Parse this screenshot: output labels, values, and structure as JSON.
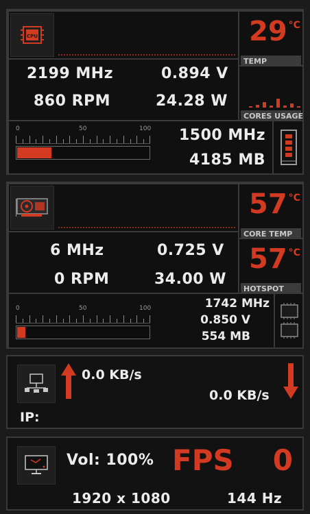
{
  "cpu": {
    "icon": "cpu-icon",
    "clock": "2199 MHz",
    "voltage": "0.894 V",
    "fan": "860 RPM",
    "power": "24.28 W",
    "temp_value": "29",
    "temp_unit": "°C",
    "temp_label": "TEMP",
    "cores_usage_label": "CORES USAGE",
    "cores_usage_bars": [
      0,
      0.3,
      0.6,
      0.2,
      0.9,
      0.2,
      0.4,
      0.1
    ],
    "ram_clock": "1500 MHz",
    "ram_used": "4185 MB",
    "gauge_ticks": [
      "0",
      "50",
      "100"
    ],
    "gauge_level": 0.27
  },
  "gpu": {
    "icon": "gpu-card-icon",
    "clock": "6 MHz",
    "voltage": "0.725 V",
    "fan": "0 RPM",
    "power": "34.00 W",
    "core_temp_value": "57",
    "core_temp_unit": "°C",
    "core_temp_label": "CORE TEMP",
    "hotspot_value": "57",
    "hotspot_unit": "°C",
    "hotspot_label": "HOTSPOT",
    "mem_clock": "1742 MHz",
    "mem_voltage": "0.850 V",
    "mem_used": "554 MB",
    "gauge_ticks": [
      "0",
      "50",
      "100"
    ],
    "gauge_level": 0.07
  },
  "network": {
    "icon": "network-icon",
    "upload": "0.0 KB/s",
    "download": "0.0 KB/s",
    "ip_label": "IP:"
  },
  "display": {
    "icon": "monitor-icon",
    "volume": "Vol: 100%",
    "fps_label": "FPS",
    "fps_value": "0",
    "resolution": "1920 x 1080",
    "refresh": "144 Hz"
  },
  "colors": {
    "accent": "#d23a22",
    "background": "#121212",
    "border": "#3a3a3a"
  }
}
